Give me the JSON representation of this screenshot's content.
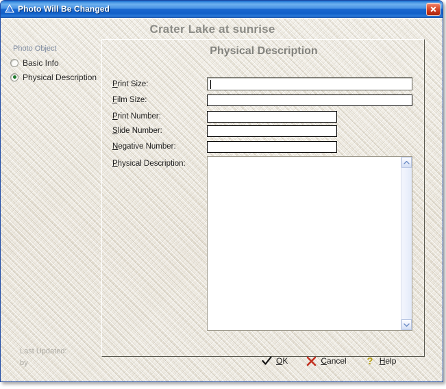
{
  "window": {
    "title": "Photo Will Be Changed",
    "title_icon": "blue-triangle-icon",
    "close_icon": "close-icon",
    "close_label": "Close"
  },
  "record": {
    "heading": "Crater Lake at sunrise"
  },
  "nav": {
    "group_label": "Photo Object",
    "items": [
      {
        "label": "Basic Info",
        "selected": false
      },
      {
        "label": "Physical Description",
        "selected": true
      }
    ]
  },
  "panel": {
    "title": "Physical Description",
    "fields": [
      {
        "label": "Print Size:",
        "accel": "P",
        "value": "",
        "focused": true,
        "type": "text"
      },
      {
        "label": "Film Size:",
        "accel": "F",
        "value": "",
        "focused": false,
        "type": "text"
      },
      {
        "label": "Print Number:",
        "accel": "P",
        "value": "",
        "focused": false,
        "type": "text"
      },
      {
        "label": "Slide Number:",
        "accel": "S",
        "value": "",
        "focused": false,
        "type": "text"
      },
      {
        "label": "Negative Number:",
        "accel": "N",
        "value": "",
        "focused": false,
        "type": "text"
      },
      {
        "label": "Physical Description:",
        "accel": "P",
        "value": "",
        "focused": false,
        "type": "textarea"
      }
    ],
    "scrollbar": {
      "up_icon": "chevron-up-icon",
      "down_icon": "chevron-down-icon"
    }
  },
  "footer": {
    "last_updated_label": "Last Updated:",
    "by_label": "by",
    "actions": [
      {
        "label": "OK",
        "accel": "O",
        "icon": "checkmark-icon",
        "color": "#000000"
      },
      {
        "label": "Cancel",
        "accel": "C",
        "icon": "red-x-icon",
        "color": "#c23020"
      },
      {
        "label": "Help",
        "accel": "H",
        "icon": "question-mark-icon",
        "color": "#b8a21c"
      }
    ]
  },
  "colors": {
    "titlebar_blue": "#1967d0",
    "close_red": "#c5331a",
    "background_beige": "#e9e4d9",
    "heading_gray": "#8b8b86",
    "nav_label_blue": "#7d8aa0",
    "radio_green": "#1e7a2e",
    "footer_gray": "#adaba4"
  }
}
